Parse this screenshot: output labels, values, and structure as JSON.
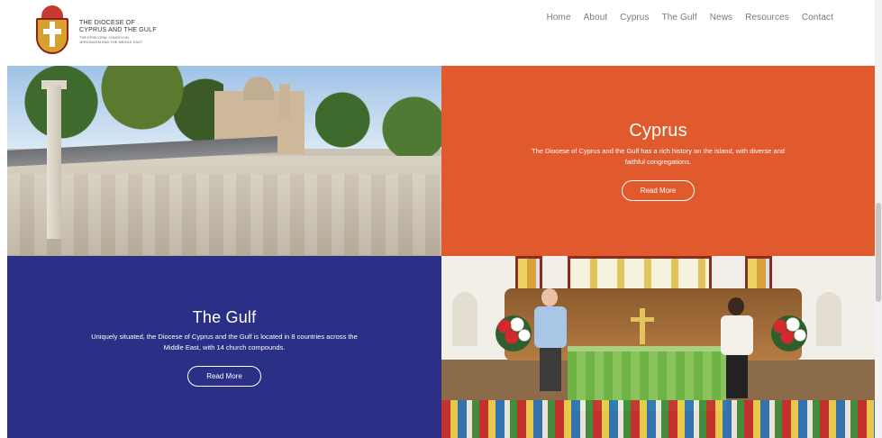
{
  "logo": {
    "line1": "THE DIOCESE OF",
    "line2": "CYPRUS AND THE GULF",
    "line3": "THE EPISCOPAL CHURCH IN",
    "line4": "JERUSALEM AND THE MIDDLE EAST"
  },
  "nav": [
    "Home",
    "About",
    "Cyprus",
    "The Gulf",
    "News",
    "Resources",
    "Contact"
  ],
  "tiles": {
    "cyprus": {
      "title": "Cyprus",
      "desc": "The Diocese of Cyprus and the Gulf has a rich history on the island, with diverse and faithful congregations.",
      "button": "Read More"
    },
    "gulf": {
      "title": "The Gulf",
      "desc": "Uniquely situated, the Diocese of Cyprus and the Gulf is located in 8 countries across the Middle East, with 14 church compounds.",
      "button": "Read More"
    }
  }
}
